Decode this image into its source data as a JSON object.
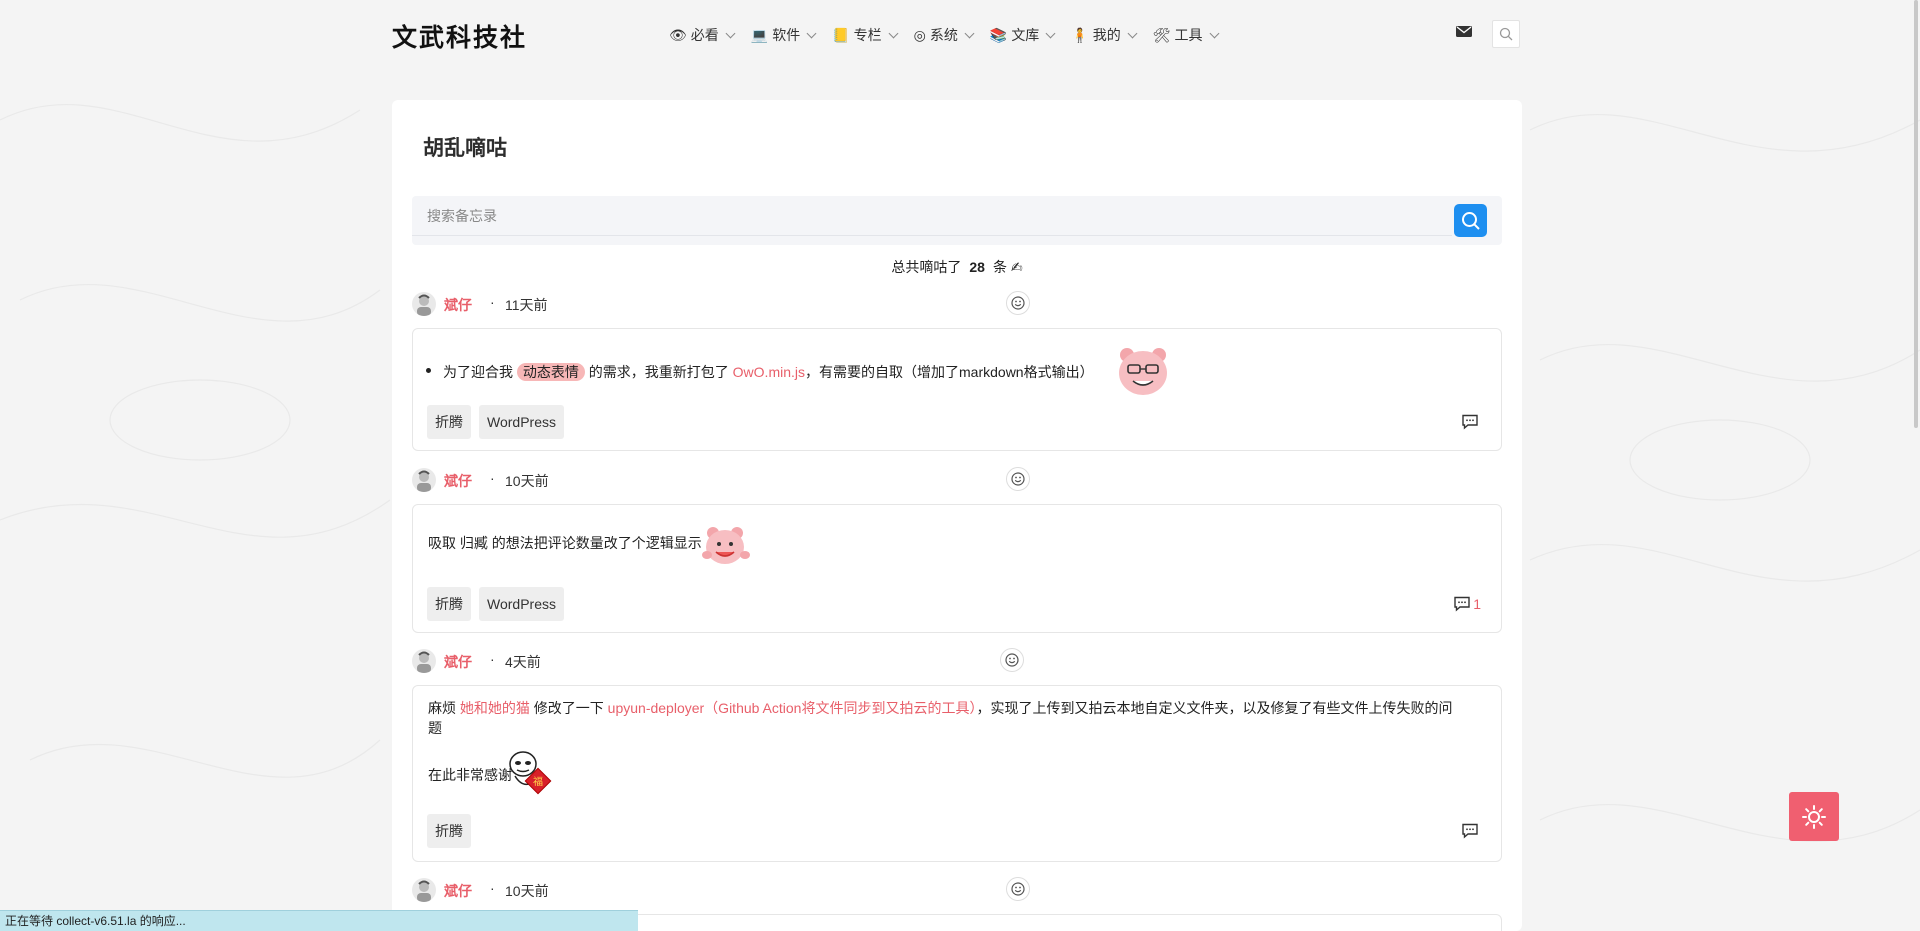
{
  "site": {
    "logo": "文武科技社"
  },
  "nav": [
    {
      "icon": "eye-icon",
      "glyph": "👁",
      "label": "必看"
    },
    {
      "icon": "laptop-icon",
      "glyph": "💻",
      "label": "软件"
    },
    {
      "icon": "notebook-icon",
      "glyph": "📒",
      "label": "专栏"
    },
    {
      "icon": "system-icon",
      "glyph": "◎",
      "label": "系统"
    },
    {
      "icon": "books-icon",
      "glyph": "📚",
      "label": "文库"
    },
    {
      "icon": "person-icon",
      "glyph": "🧍",
      "label": "我的"
    },
    {
      "icon": "tools-icon",
      "glyph": "🛠",
      "label": "工具"
    }
  ],
  "page": {
    "title": "胡乱嘀咕"
  },
  "search": {
    "placeholder": "搜索备忘录"
  },
  "count": {
    "prefix": "总共嘀咕了",
    "number": "28",
    "suffix": "条",
    "icon": "✍"
  },
  "posts": [
    {
      "author": "斌仔",
      "dot": "·",
      "time": "11天前",
      "text": {
        "a": "为了迎合我",
        "b": "动态表情",
        "c": "的需求，我重新打包了",
        "d": "OwO.min.js",
        "e": "，有需要的自取（增加了markdown格式输出）"
      },
      "tags": [
        "折腾",
        "WordPress"
      ],
      "comments": ""
    },
    {
      "author": "斌仔",
      "dot": "·",
      "time": "10天前",
      "text": {
        "a": "吸取",
        "b": "归臧",
        "c": "的想法把评论数量改了个逻辑显示"
      },
      "tags": [
        "折腾",
        "WordPress"
      ],
      "comments": "1"
    },
    {
      "author": "斌仔",
      "dot": "·",
      "time": "4天前",
      "text": {
        "a": "麻烦",
        "b": "她和她的猫",
        "c": "修改了一下",
        "d": "upyun-deployer（Github Action将文件同步到又拍云的工具）",
        "e": "，实现了上传到又拍云本地自定义文件夹，以及修复了有些文件上传失败的问",
        "f": "题",
        "g": "在此非常感谢"
      },
      "tags": [
        "折腾"
      ],
      "comments": ""
    },
    {
      "author": "斌仔",
      "dot": "·",
      "time": "10天前"
    }
  ],
  "sticker": {
    "fu": "福"
  },
  "statusbar": "正在等待 collect-v6.51.la 的响应...",
  "colors": {
    "accent": "#e85f6a",
    "searchBtn": "#1e8ff0",
    "fab": "#f05f70"
  }
}
